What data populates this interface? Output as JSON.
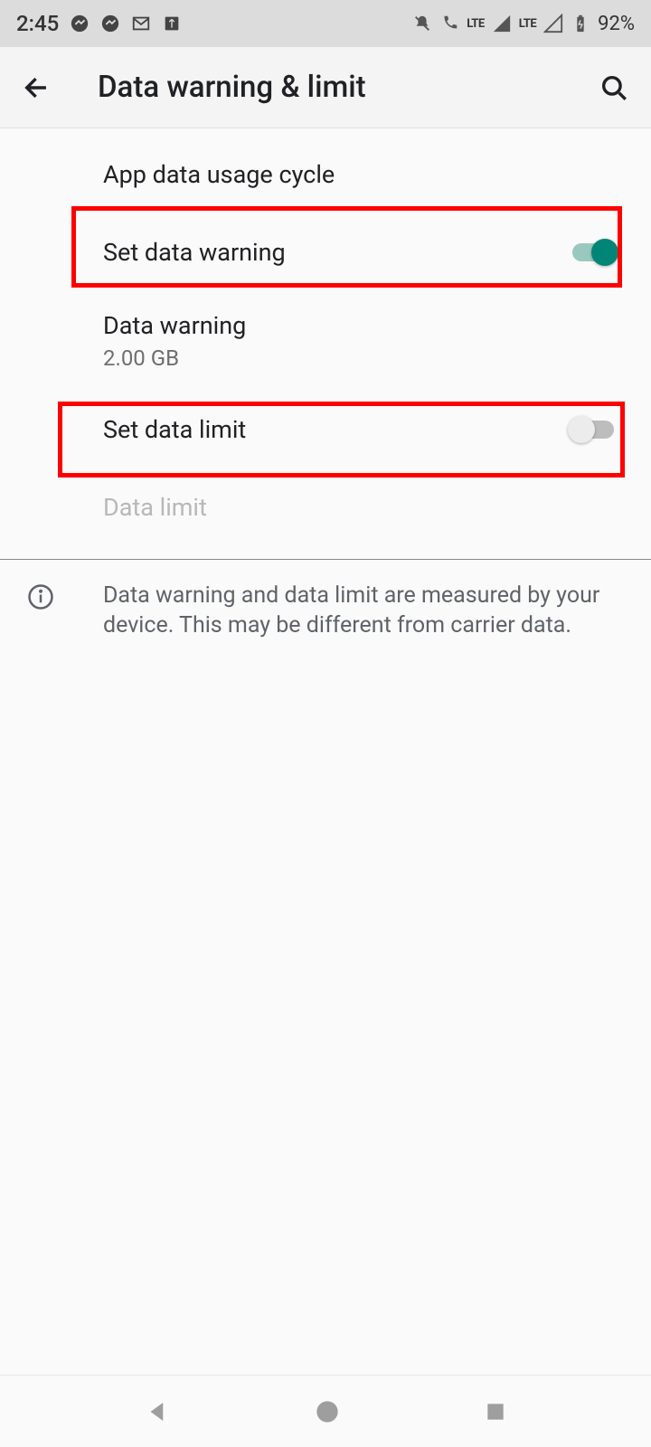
{
  "status": {
    "time": "2:45",
    "battery": "92%",
    "lte": "LTE"
  },
  "header": {
    "title": "Data warning & limit"
  },
  "rows": {
    "cycle": {
      "title": "App data usage cycle"
    },
    "set_warning": {
      "title": "Set data warning",
      "toggle": true
    },
    "data_warning": {
      "title": "Data warning",
      "value": "2.00 GB"
    },
    "set_limit": {
      "title": "Set data limit",
      "toggle": false
    },
    "data_limit": {
      "title": "Data limit"
    }
  },
  "info": {
    "text": "Data warning and data limit are measured by your device. This may be different from carrier data."
  }
}
